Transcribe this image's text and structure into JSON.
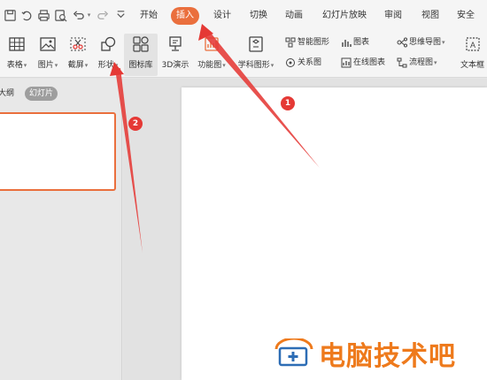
{
  "quick_access": [
    "save-icon",
    "undo-history-icon",
    "print-icon",
    "print-preview-icon",
    "undo-icon",
    "redo-icon",
    "more-icon"
  ],
  "tabs": {
    "start": "开始",
    "insert": "插入",
    "design": "设计",
    "transition": "切换",
    "animation": "动画",
    "slideshow": "幻灯片放映",
    "review": "审阅",
    "view": "视图",
    "security": "安全"
  },
  "ribbon": {
    "table": "表格",
    "picture": "图片",
    "screenshot": "截屏",
    "shape": "形状",
    "icon_library": "图标库",
    "demo3d": "3D演示",
    "function_chart": "功能图",
    "subject_shape": "学科图形",
    "smart_shape": "智能图形",
    "chart": "图表",
    "mindmap": "思维导图",
    "relation": "关系图",
    "online_chart": "在线图表",
    "flowchart": "流程图",
    "textbox": "文本框"
  },
  "panel": {
    "outline": "大纲",
    "slides": "幻灯片"
  },
  "annotations": {
    "one": "1",
    "two": "2"
  },
  "watermark": {
    "text": "电脑技术吧"
  },
  "colors": {
    "accent": "#ea6f3d",
    "arrow": "#e53935",
    "watermark": "#ee7a1c"
  }
}
